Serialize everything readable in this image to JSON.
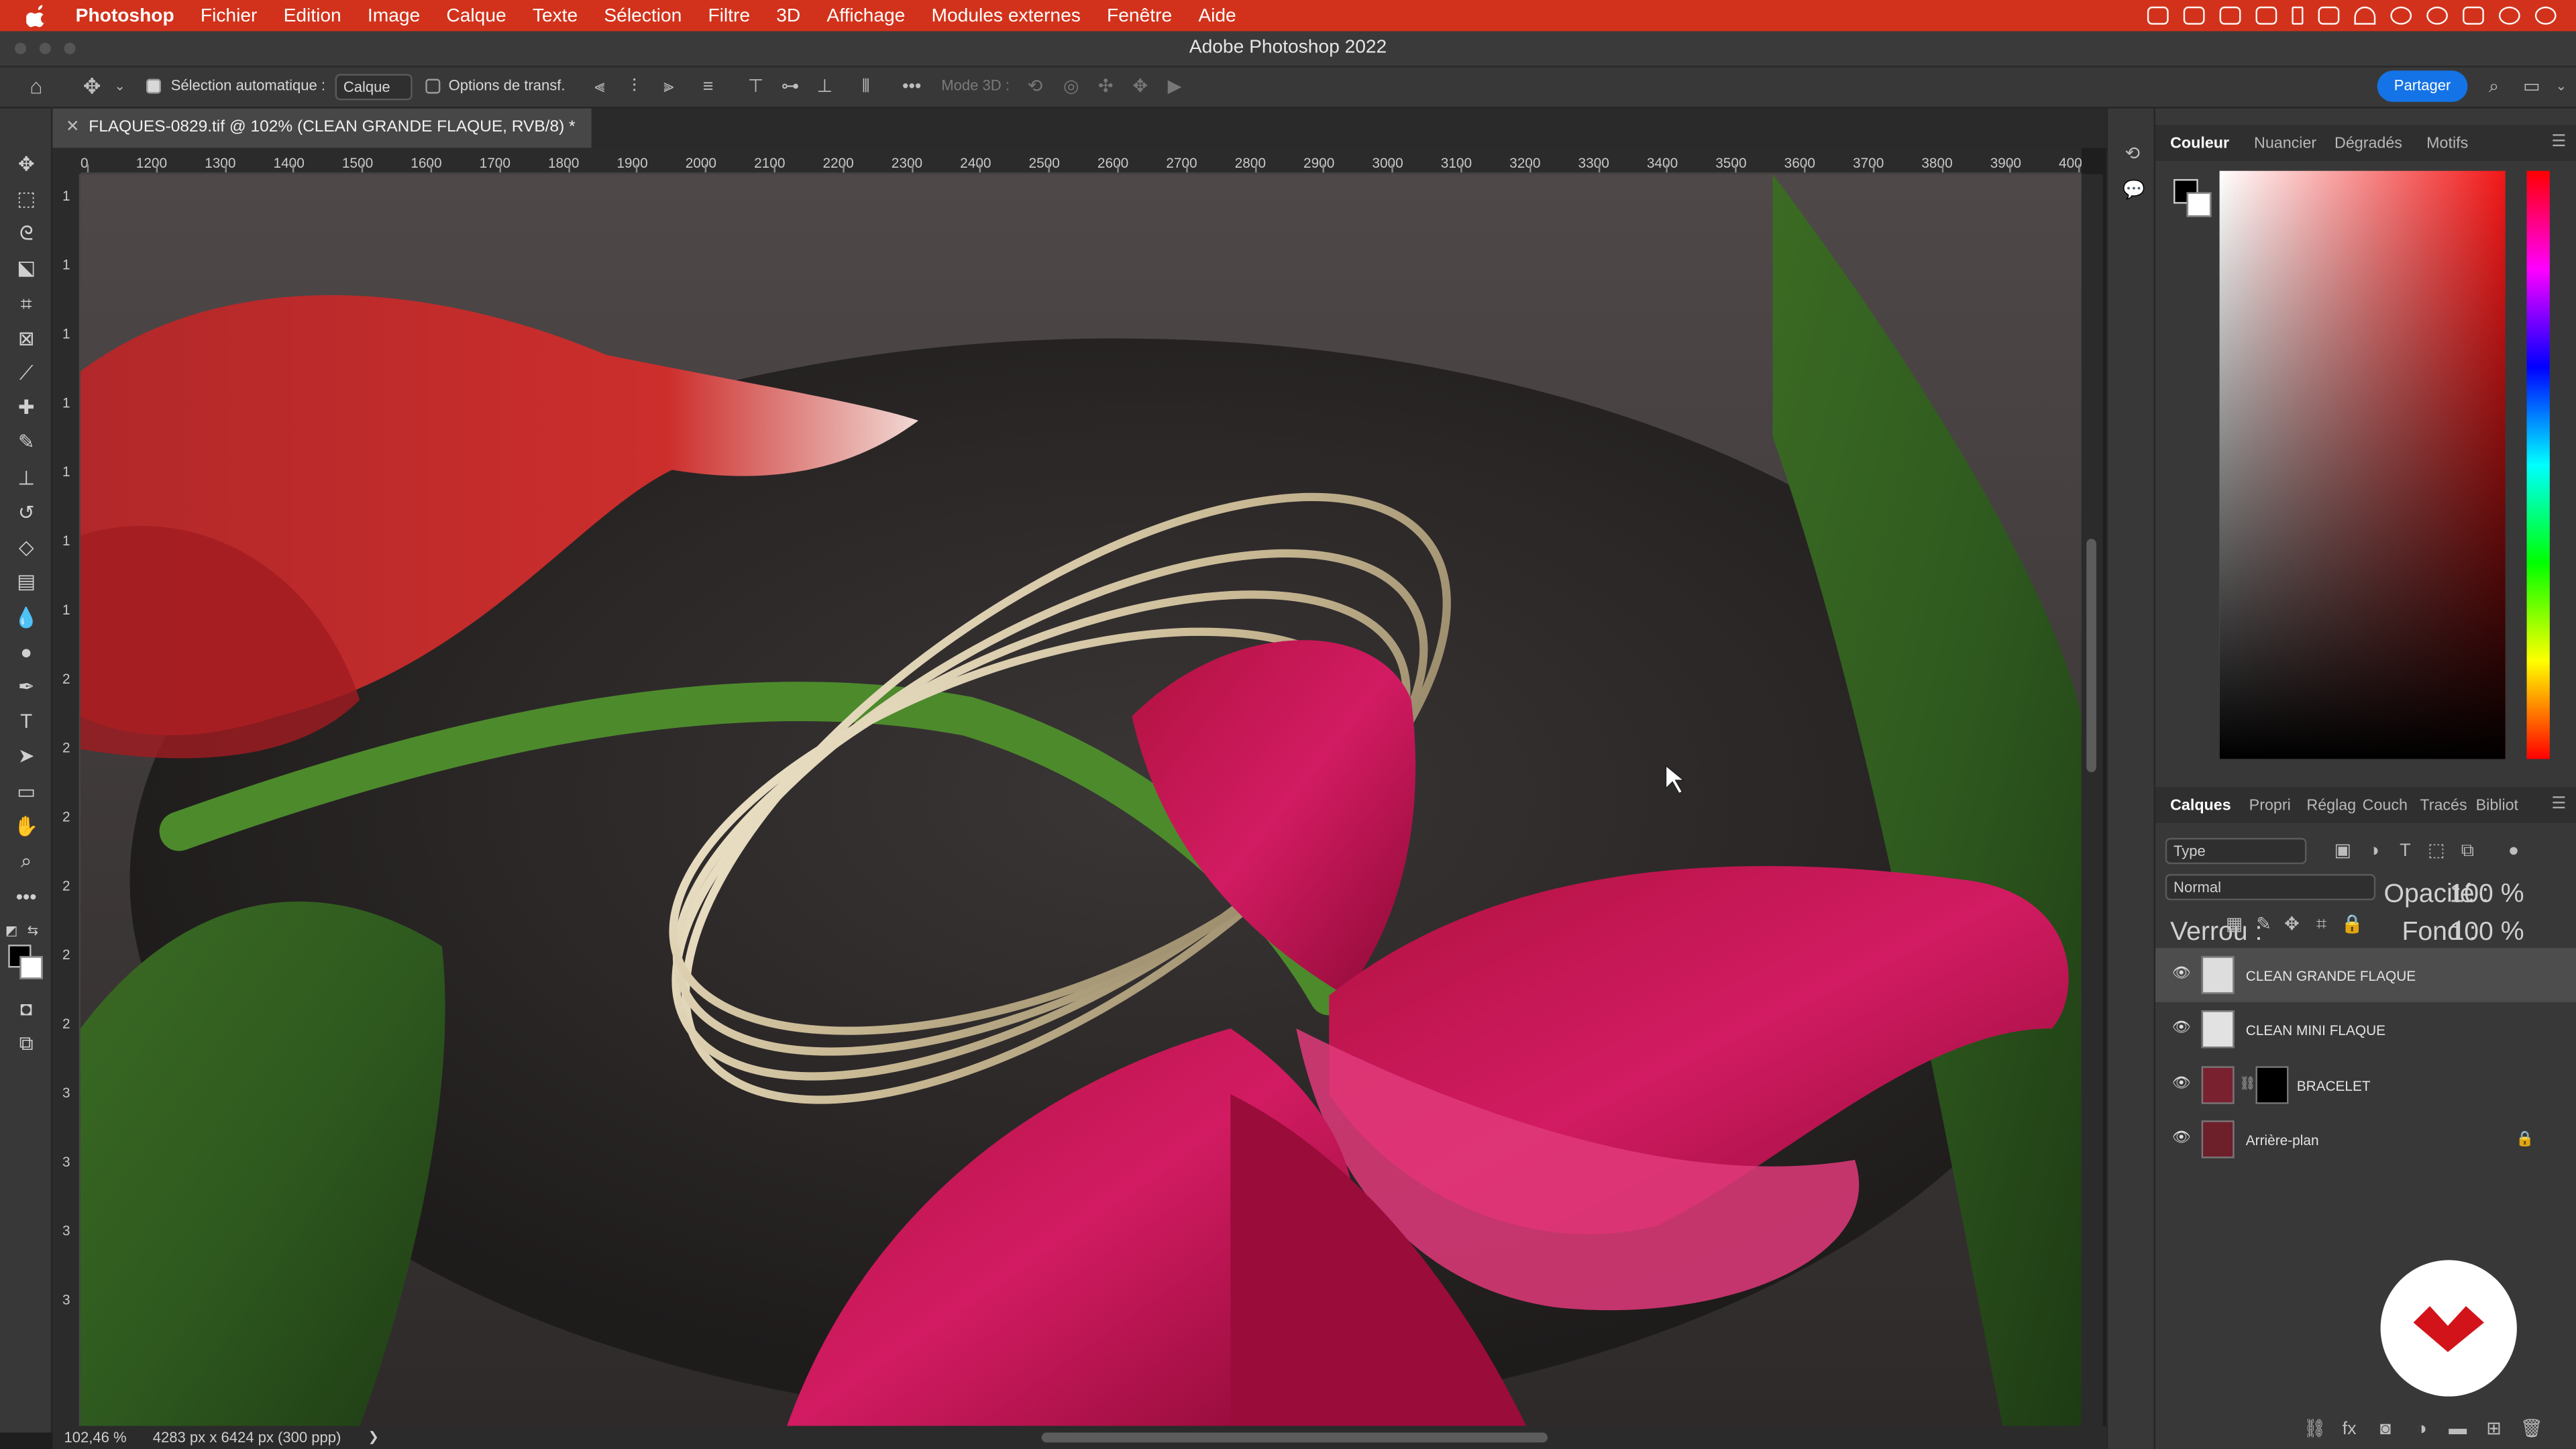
{
  "menubar": {
    "app": "Photoshop",
    "items": [
      "Fichier",
      "Edition",
      "Image",
      "Calque",
      "Texte",
      "Sélection",
      "Filtre",
      "3D",
      "Affichage",
      "Modules externes",
      "Fenêtre",
      "Aide"
    ]
  },
  "window": {
    "title": "Adobe Photoshop 2022"
  },
  "options": {
    "auto_select_label": "Sélection automatique :",
    "auto_select_value": "Calque",
    "transform_label": "Options de transf.",
    "mode3d": "Mode 3D :",
    "share": "Partager"
  },
  "document": {
    "tab": "FLAQUES-0829.tif @ 102% (CLEAN GRANDE FLAQUE, RVB/8) *"
  },
  "ruler": {
    "h": [
      "0",
      "1200",
      "1300",
      "1400",
      "1500",
      "1600",
      "1700",
      "1800",
      "1900",
      "2000",
      "2100",
      "2200",
      "2300",
      "2400",
      "2500",
      "2600",
      "2700",
      "2800",
      "2900",
      "3000",
      "3100",
      "3200",
      "3300",
      "3400",
      "3500",
      "3600",
      "3700",
      "3800",
      "3900",
      "400"
    ],
    "v": [
      "1",
      "1",
      "1",
      "1",
      "1",
      "1",
      "1",
      "2",
      "2",
      "2",
      "2",
      "2",
      "2",
      "3",
      "3",
      "3",
      "3"
    ]
  },
  "status": {
    "zoom": "102,46 %",
    "dimensions": "4283 px x 6424 px (300 ppp)",
    "arrow": "❯"
  },
  "color_panel": {
    "tabs": [
      "Couleur",
      "Nuancier",
      "Dégradés",
      "Motifs"
    ],
    "fg": "#000000",
    "bg": "#ffffff",
    "hue": "#f21717"
  },
  "layers_panel": {
    "tabs": [
      "Calques",
      "Propri",
      "Réglag",
      "Couch",
      "Tracés",
      "Bibliot"
    ],
    "filter": "Type",
    "blend": "Normal",
    "opacity_label": "Opacité :",
    "opacity": "100 %",
    "lock_label": "Verrou :",
    "fill_label": "Fond :",
    "fill": "100 %",
    "layers": [
      {
        "name": "CLEAN GRANDE FLAQUE",
        "selected": true
      },
      {
        "name": "CLEAN MINI FLAQUE",
        "selected": false
      },
      {
        "name": "BRACELET",
        "selected": false
      },
      {
        "name": "Arrière-plan",
        "selected": false
      }
    ]
  }
}
